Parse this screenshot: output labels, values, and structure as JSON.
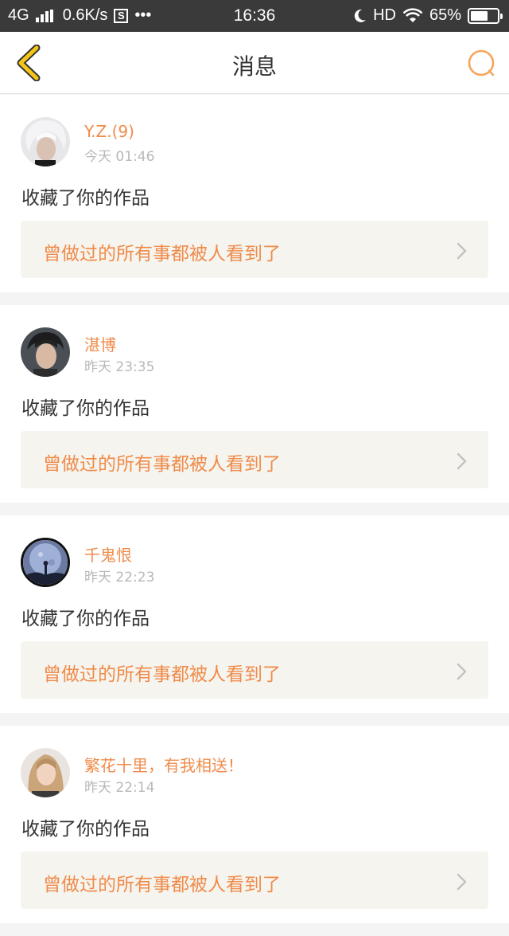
{
  "status": {
    "network": "4G",
    "speed": "0.6K/s",
    "s_icon": "S",
    "more": "•••",
    "time": "16:36",
    "hd": "HD",
    "battery": "65%",
    "battery_level": 0.65
  },
  "header": {
    "title": "消息",
    "back_icon": "chevron-left-icon",
    "search_icon": "search-icon",
    "accent_color": "#f5a623"
  },
  "messages": [
    {
      "name": "Y.Z.(9)",
      "time": "今天 01:46",
      "action": "收藏了你的作品",
      "work": "曾做过的所有事都被人看到了"
    },
    {
      "name": "湛博",
      "time": "昨天 23:35",
      "action": "收藏了你的作品",
      "work": "曾做过的所有事都被人看到了"
    },
    {
      "name": "千鬼恨",
      "time": "昨天 22:23",
      "action": "收藏了你的作品",
      "work": "曾做过的所有事都被人看到了"
    },
    {
      "name": "繁花十里，有我相送！",
      "time": "昨天 22:14",
      "action": "收藏了你的作品",
      "work": "曾做过的所有事都被人看到了"
    }
  ],
  "colors": {
    "name": "#f08b4a",
    "time": "#b8b8b8",
    "work_bg": "#f5f4ef"
  }
}
